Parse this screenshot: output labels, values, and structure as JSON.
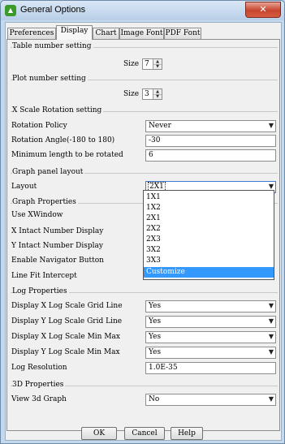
{
  "window": {
    "title": "General Options",
    "app_icon": "chart-app-icon",
    "close_glyph": "✕"
  },
  "tabs": [
    {
      "label": "Preferences"
    },
    {
      "label": "Display"
    },
    {
      "label": "Chart"
    },
    {
      "label": "Image Font"
    },
    {
      "label": "PDF Font"
    }
  ],
  "active_tab": "Display",
  "table_number": {
    "title": "Table number setting",
    "size_label": "Size",
    "size_value": "7"
  },
  "plot_number": {
    "title": "Plot number setting",
    "size_label": "Size",
    "size_value": "3"
  },
  "x_scale": {
    "title": "X Scale Rotation setting",
    "policy_label": "Rotation Policy",
    "policy_value": "Never",
    "angle_label": "Rotation Angle(-180 to 180)",
    "angle_value": "-30",
    "min_len_label": "Minimum length to be rotated",
    "min_len_value": "6"
  },
  "graph_panel": {
    "title": "Graph panel layout",
    "layout_label": "Layout",
    "layout_value": "2X1"
  },
  "layout_options": [
    "1X1",
    "1X2",
    "2X1",
    "2X2",
    "2X3",
    "3X2",
    "3X3",
    "Customize"
  ],
  "layout_highlighted": "Customize",
  "graph_props": {
    "title": "Graph Properties",
    "xwindow_label": "Use XWindow",
    "x_intact_label": "X Intact Number Display",
    "y_intact_label": "Y Intact Number Display",
    "nav_label": "Enable Navigator Button",
    "linefit_label": "Line Fit Intercept"
  },
  "log_props": {
    "title": "Log Properties",
    "x_grid_label": "Display X Log Scale Grid Line",
    "x_grid_value": "Yes",
    "y_grid_label": "Display Y Log Scale Grid Line",
    "y_grid_value": "Yes",
    "x_minmax_label": "Display X Log Scale Min Max",
    "x_minmax_value": "Yes",
    "y_minmax_label": "Display Y Log Scale Min Max",
    "y_minmax_value": "Yes",
    "resolution_label": "Log Resolution",
    "resolution_value": "1.0E-35"
  },
  "props_3d": {
    "title": "3D Properties",
    "view_label": "View 3d Graph",
    "view_value": "No"
  },
  "buttons": {
    "ok": "OK",
    "cancel": "Cancel",
    "help": "Help"
  }
}
